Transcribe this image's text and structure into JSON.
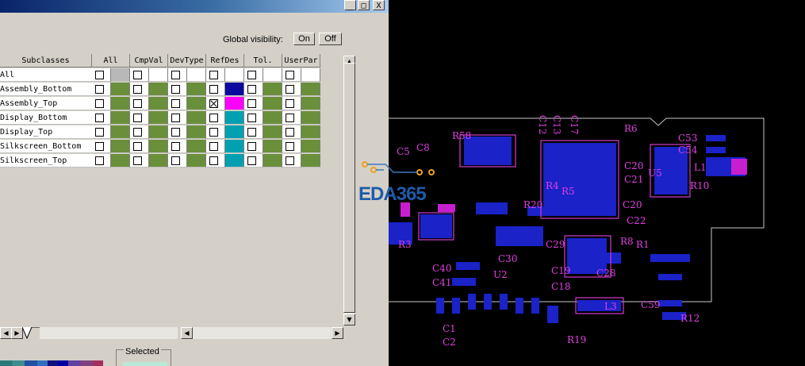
{
  "window": {
    "buttons": [
      "_",
      "□",
      "X"
    ]
  },
  "visibility": {
    "label": "Global visibility:",
    "on_label": "On",
    "off_label": "Off"
  },
  "grid": {
    "headers": [
      "Subclasses",
      "All",
      "CmpVal",
      "DevType",
      "RefDes",
      "Tol.",
      "UserPar"
    ],
    "rows": [
      {
        "label": "All",
        "checks": [
          false,
          false,
          false,
          false,
          false,
          false
        ]
      },
      {
        "label": "Assembly_Bottom",
        "checks": [
          false,
          false,
          false,
          false,
          false,
          false
        ]
      },
      {
        "label": "Assembly_Top",
        "checks": [
          false,
          false,
          false,
          true,
          false,
          false
        ]
      },
      {
        "label": "Display_Bottom",
        "checks": [
          false,
          false,
          false,
          false,
          false,
          false
        ]
      },
      {
        "label": "Display_Top",
        "checks": [
          false,
          false,
          false,
          false,
          false,
          false
        ]
      },
      {
        "label": "Silkscreen_Bottom",
        "checks": [
          false,
          false,
          false,
          false,
          false,
          false
        ]
      },
      {
        "label": "Silkscreen_Top",
        "checks": [
          false,
          false,
          false,
          false,
          false,
          false
        ]
      }
    ],
    "swatch_colors": {
      "gray": "#b8b8b8",
      "green": "#6a8f3a",
      "blue": "#0a0a9e",
      "magenta": "#ff00ff",
      "teal": "#00a0b0"
    }
  },
  "bottom": {
    "selected_label": "Selected"
  },
  "pcb": {
    "watermark": "EDA365",
    "refs": [
      "C17",
      "C12",
      "C13",
      "R6",
      "C53",
      "C54",
      "C5",
      "C8",
      "R58",
      "C20",
      "C21",
      "U5",
      "L1",
      "R10",
      "R4",
      "R5",
      "C20",
      "C22",
      "C29",
      "R8",
      "R1",
      "R3",
      "R20",
      "C30",
      "C40",
      "C41",
      "U2",
      "C19",
      "C28",
      "C18",
      "L3",
      "C59",
      "R12",
      "C1",
      "C2",
      "R19"
    ]
  }
}
